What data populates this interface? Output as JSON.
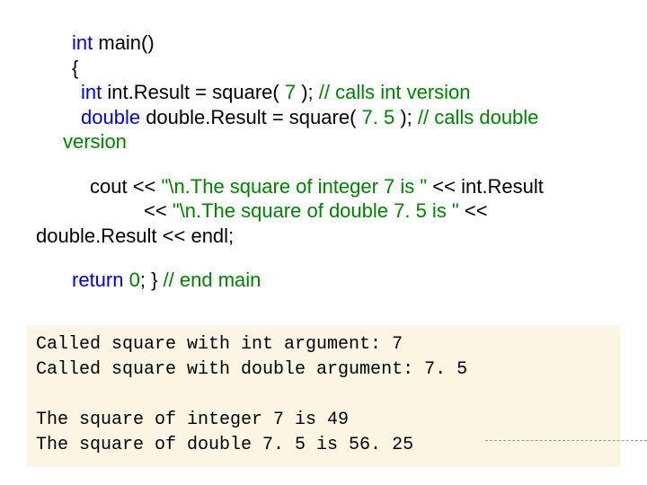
{
  "code": {
    "l1a": "int",
    "l1b": " main()",
    "l2": "{",
    "l3a": " int",
    "l3b": " int.Result = square( ",
    "l3c": "7",
    "l3d": " );         ",
    "l3e": "// calls int version",
    "l4a": "double",
    "l4b": " double.Result = square( ",
    "l4c": "7. 5",
    "l4d": " ); ",
    "l4e": "// calls double",
    "l5": "version",
    "l6a": "cout << ",
    "l6b": "\"\\n.The square of integer 7 is \"",
    "l6c": " << int.Result",
    "l7a": "<< ",
    "l7b": "\"\\n.The square of double 7. 5 is \"",
    "l7c": " <<",
    "l8": "double.Result << endl;",
    "l9a": "return",
    "l9b": " ",
    "l9c": "0",
    "l9d": "; } ",
    "l9e": "// end main"
  },
  "output": {
    "o1": "Called square with int argument: 7",
    "o2": "Called square with double argument: 7. 5",
    "o3": "The square of integer 7 is 49",
    "o4": "The square of double 7. 5 is 56. 25"
  }
}
